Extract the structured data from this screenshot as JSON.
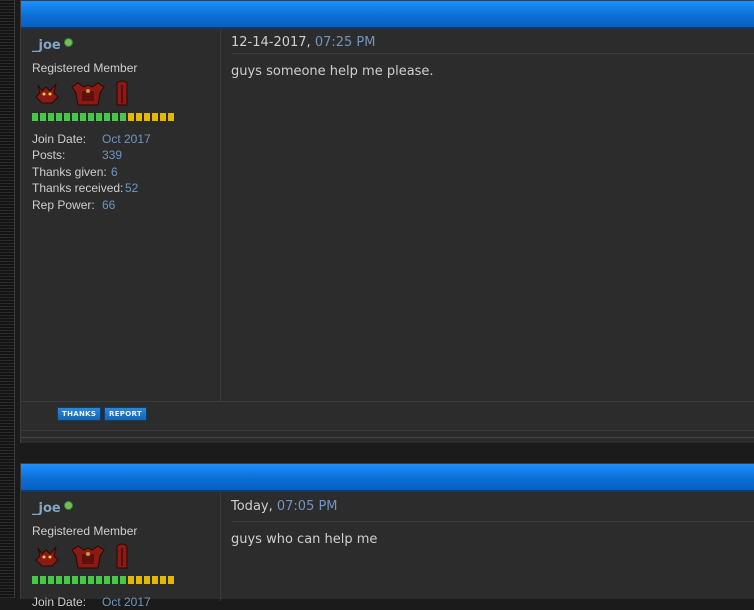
{
  "colors": {
    "header_blue": "#1f8fff",
    "link": "#6f95c0",
    "username": "#7fa6c9",
    "online": "#6fbf5a",
    "rep_green": "#48c848",
    "rep_yellow": "#e2b800"
  },
  "posts": [
    {
      "username": "_joe",
      "user_title": "Registered Member",
      "badges": [
        "devil-head-badge",
        "armor-badge",
        "red-totem-badge"
      ],
      "rep_bar": {
        "green": 12,
        "yellow": 6
      },
      "stats": [
        {
          "label": "Join Date:",
          "value": "Oct 2017"
        },
        {
          "label": "Posts:",
          "value": "339"
        },
        {
          "label": "Thanks given:",
          "value": "6"
        },
        {
          "label": "Thanks received:",
          "value": "52"
        },
        {
          "label": "Rep Power:",
          "value": "66"
        }
      ],
      "date": "12-14-2017,",
      "time": "07:25 PM",
      "message": "guys someone help me please.",
      "buttons": {
        "thanks": "THANKS",
        "report": "REPORT"
      }
    },
    {
      "username": "_joe",
      "user_title": "Registered Member",
      "badges": [
        "devil-head-badge",
        "armor-badge",
        "red-totem-badge"
      ],
      "rep_bar": {
        "green": 12,
        "yellow": 6
      },
      "stats": [
        {
          "label": "Join Date:",
          "value": "Oct 2017"
        }
      ],
      "date": "Today,",
      "time": "07:05 PM",
      "message": "guys who can help me"
    }
  ]
}
